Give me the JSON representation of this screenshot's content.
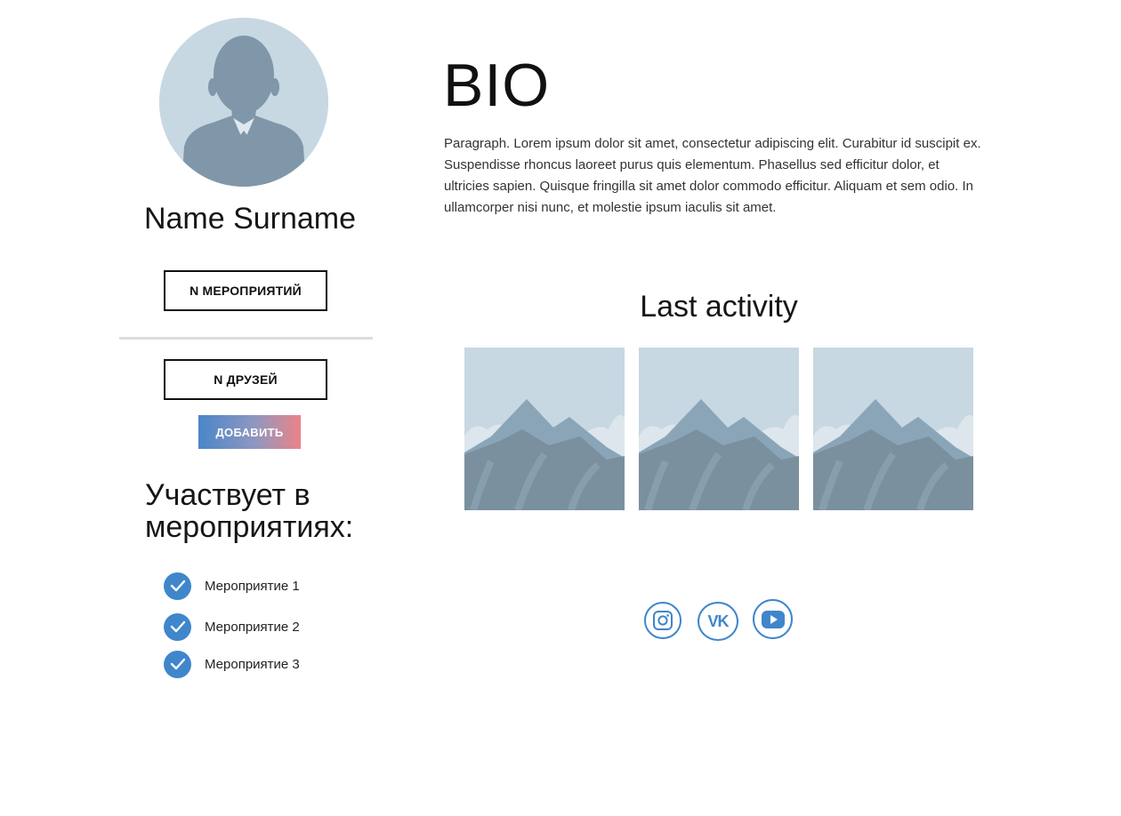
{
  "profile": {
    "name": "Name Surname",
    "events_button": "N МЕРОПРИЯТИЙ",
    "friends_button": "N ДРУЗЕЙ",
    "add_button": "ДОБАВИТЬ"
  },
  "events": {
    "title": "Участвует в мероприятиях:",
    "items": [
      "Мероприятие 1",
      "Мероприятие 2",
      "Мероприятие 3"
    ]
  },
  "bio": {
    "title": "BIO",
    "text": "Paragraph. Lorem ipsum dolor sit amet, consectetur adipiscing elit. Curabitur id suscipit ex. Suspendisse rhoncus laoreet purus quis elementum. Phasellus sed efficitur dolor, et ultricies sapien. Quisque fringilla sit amet dolor commodo efficitur. Aliquam et sem odio. In ullamcorper nisi nunc, et molestie ipsum iaculis sit amet."
  },
  "activity": {
    "title": "Last activity",
    "thumbnails": [
      "mountain-placeholder",
      "mountain-placeholder",
      "mountain-placeholder"
    ]
  },
  "social": {
    "icons": [
      "instagram-icon",
      "vk-icon",
      "youtube-icon"
    ],
    "vk_text": "VK"
  },
  "colors": {
    "accent": "#3f86cb",
    "placeholder_bg": "#c7d8e2",
    "placeholder_fg": "#7f97a8",
    "gradient_start": "#4a86c8",
    "gradient_end": "#ea8489"
  }
}
